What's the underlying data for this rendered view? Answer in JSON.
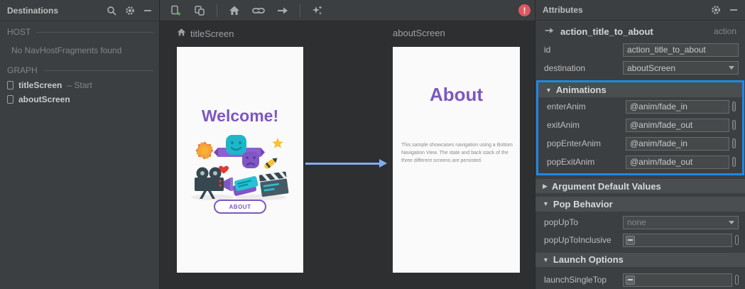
{
  "colors": {
    "accent_purple": "#7e57c2",
    "selection_blue": "#1e88e5",
    "arrow_blue": "#84acf0",
    "error_red": "#db5860",
    "panel_bg": "#3c3f41",
    "surface_bg": "#2d2f31",
    "card_bg": "#fafafa"
  },
  "destinations_panel": {
    "title": "Destinations",
    "host_label": "HOST",
    "host_empty": "No NavHostFragments found",
    "graph_label": "GRAPH",
    "items": [
      {
        "name": "titleScreen",
        "suffix": "– Start"
      },
      {
        "name": "aboutScreen",
        "suffix": ""
      }
    ]
  },
  "toolbar": {
    "icons": [
      "new-destination",
      "nested-graph",
      "assign-start-destination",
      "add-deep-link",
      "add-action",
      "auto-arrange"
    ],
    "error_badge": "!"
  },
  "surface": {
    "screens": [
      {
        "label": "titleScreen",
        "title": "Welcome!",
        "button": "ABOUT"
      },
      {
        "label": "aboutScreen",
        "title": "About",
        "body": "This sample showcases navigation using a Bottom Navigation View. The state and back stack of the three different screens are persisted."
      }
    ]
  },
  "attributes": {
    "title": "Attributes",
    "action_name": "action_title_to_about",
    "action_type": "action",
    "id_label": "id",
    "id_value": "action_title_to_about",
    "destination_label": "destination",
    "destination_value": "aboutScreen",
    "animations": {
      "title": "Animations",
      "rows": [
        {
          "label": "enterAnim",
          "value": "@anim/fade_in"
        },
        {
          "label": "exitAnim",
          "value": "@anim/fade_out"
        },
        {
          "label": "popEnterAnim",
          "value": "@anim/fade_in"
        },
        {
          "label": "popExitAnim",
          "value": "@anim/fade_out"
        }
      ]
    },
    "argument_defaults": {
      "title": "Argument Default Values"
    },
    "pop_behavior": {
      "title": "Pop Behavior",
      "popupto_label": "popUpTo",
      "popupto_value": "none",
      "inclusive_label": "popUpToInclusive"
    },
    "launch_options": {
      "title": "Launch Options",
      "single_top_label": "launchSingleTop"
    }
  }
}
